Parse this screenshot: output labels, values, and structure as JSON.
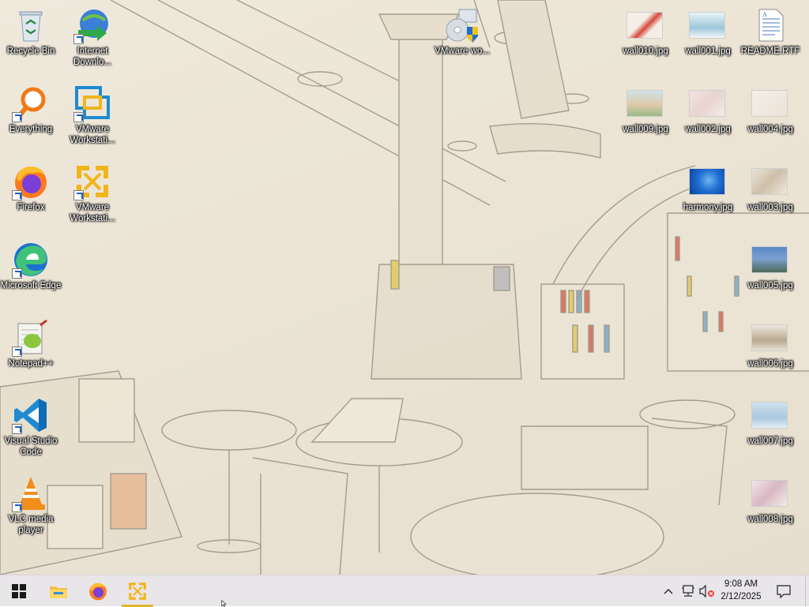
{
  "desktop": {
    "left_column": [
      {
        "label": "Recycle Bin",
        "icon": "recycle-bin-icon"
      },
      {
        "label": "Everything",
        "icon": "everything-search-icon"
      },
      {
        "label": "Firefox",
        "icon": "firefox-icon"
      },
      {
        "label": "Microsoft Edge",
        "icon": "edge-icon"
      },
      {
        "label": "Notepad++",
        "icon": "notepad-plus-plus-icon"
      },
      {
        "label": "Visual Studio Code",
        "icon": "vscode-icon"
      },
      {
        "label": "VLC media player",
        "icon": "vlc-icon"
      }
    ],
    "second_column": [
      {
        "label": "Internet Downlo...",
        "icon": "internet-download-manager-icon"
      },
      {
        "label": "VMware Workstati...",
        "icon": "vmware-workstation-icon"
      },
      {
        "label": "VMware Workstati...",
        "icon": "vmware-workstation-alt-icon"
      }
    ],
    "top_middle": {
      "label": "VMware wo...",
      "icon": "vmware-installer-icon"
    },
    "right_files": [
      {
        "label": "wall010.jpg"
      },
      {
        "label": "wall001.jpg"
      },
      {
        "label": "README.RTF"
      },
      {
        "label": "wall009.jpg"
      },
      {
        "label": "wall002.jpg"
      },
      {
        "label": "wall004.jpg"
      },
      {
        "label": "harmony.jpg"
      },
      {
        "label": "wall003.jpg"
      },
      {
        "label": "wall005.jpg"
      },
      {
        "label": "wall006.jpg"
      },
      {
        "label": "wall007.jpg"
      },
      {
        "label": "wall008.jpg"
      }
    ]
  },
  "taskbar": {
    "pinned": [
      {
        "name": "start-button",
        "icon": "windows-logo-icon"
      },
      {
        "name": "file-explorer",
        "icon": "folder-icon"
      },
      {
        "name": "firefox",
        "icon": "firefox-icon"
      },
      {
        "name": "vmware-workstation",
        "icon": "vmware-workstation-icon",
        "active": true
      }
    ],
    "tray": {
      "show_hidden": "chevron-up-icon",
      "network": "network-icon",
      "volume": "volume-muted-icon",
      "notifications": "action-center-icon"
    },
    "clock": {
      "time": "9:08 AM",
      "date": "2/12/2025"
    }
  },
  "colors": {
    "taskbar_bg": "#e9e6ea",
    "active_indicator": "#e0b534",
    "vmware_orange": "#f1b51c",
    "vscode_blue": "#1f8ad2",
    "edge_blue": "#1f6fd1"
  }
}
